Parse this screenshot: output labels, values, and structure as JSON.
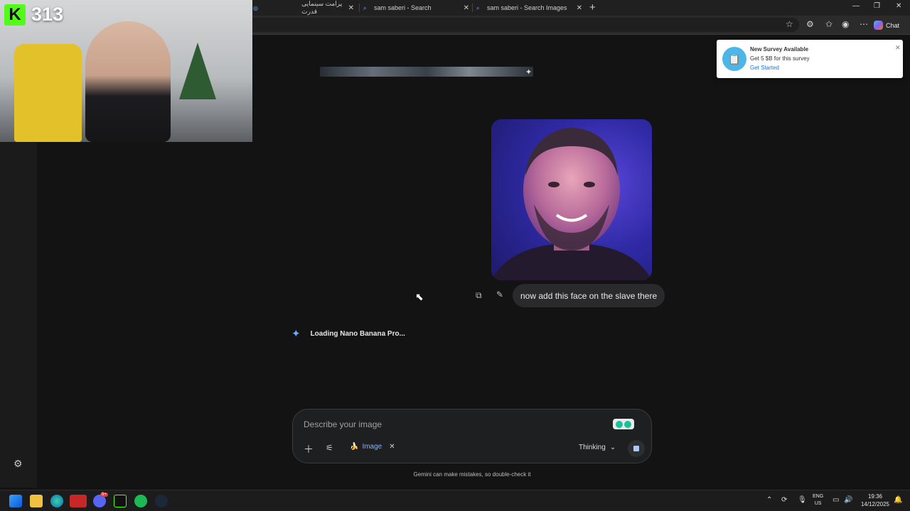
{
  "browser": {
    "tabs": [
      {
        "title": "پرامت سینمایی قدرت",
        "icon": "copilot-icon"
      },
      {
        "title": "sam saberi - Search",
        "icon": "search-icon"
      },
      {
        "title": "sam saberi - Search Images",
        "icon": "search-icon"
      }
    ],
    "new_tab_glyph": "+",
    "chat_label": "Chat"
  },
  "stream_overlay": {
    "kick_logo": "K",
    "viewer_count": "313"
  },
  "notification": {
    "title": "New Survey Available",
    "subtitle": "Get 5 $B for this survey",
    "link": "Get Started"
  },
  "conversation": {
    "user_message": "now add this face on the slave there",
    "loading_text": "Loading Nano Banana Pro..."
  },
  "composer": {
    "placeholder": "Describe your image",
    "tool_chip_label": "Image",
    "tool_chip_emoji": "🍌",
    "mode_label": "Thinking"
  },
  "disclaimer": "Gemini can make mistakes, so double-check it",
  "taskbar": {
    "lang_line1": "ENG",
    "lang_line2": "US",
    "time": "19:36",
    "date": "14/12/2025",
    "discord_badge": "9+"
  },
  "colors": {
    "page_bg": "#131314",
    "accent": "#8ab4f8",
    "kick_green": "#53fc18"
  }
}
